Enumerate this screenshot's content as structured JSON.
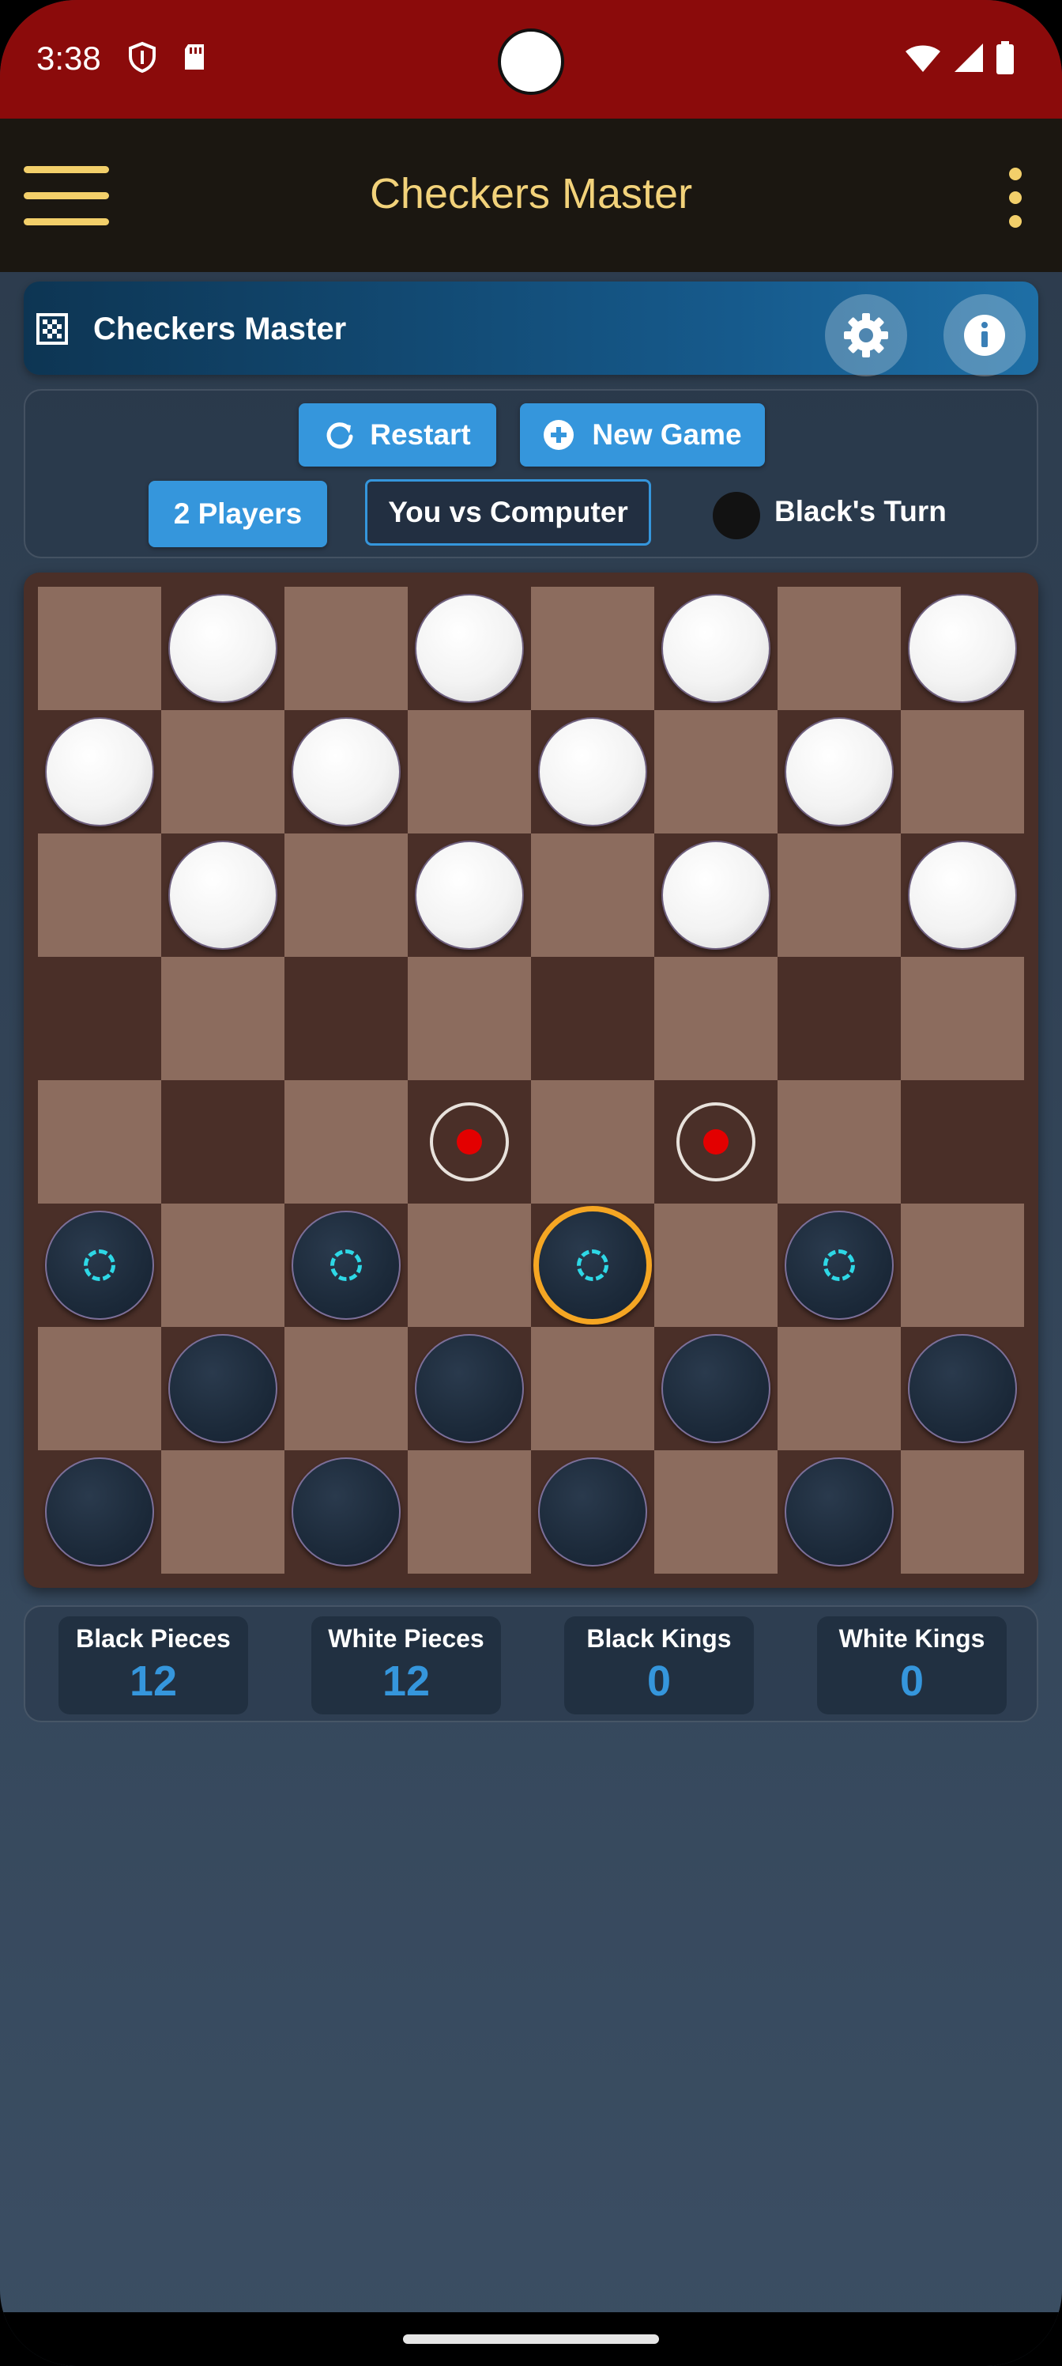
{
  "status_bar": {
    "time": "3:38"
  },
  "app_bar": {
    "title": "Checkers Master"
  },
  "header": {
    "title": "Checkers Master"
  },
  "controls": {
    "restart_label": "Restart",
    "new_game_label": "New Game",
    "mode_two_players": "2 Players",
    "mode_vs_computer": "You vs Computer",
    "turn_text": "Black's Turn"
  },
  "board": {
    "size": 8,
    "rows": [
      "-w-w-w-w",
      "w-w-w-w-",
      "-w-w-w-w",
      "--------",
      "---x-x--",
      "b-b-B-b-",
      "-b-b-b-b",
      "b-b-b-b-"
    ],
    "legend": {
      "w": "white piece",
      "b": "black piece",
      "B": "selected black piece",
      "x": "possible move"
    },
    "movable_pieces": [
      [
        5,
        0
      ],
      [
        5,
        2
      ],
      [
        5,
        4
      ],
      [
        5,
        6
      ]
    ]
  },
  "stats": [
    {
      "label": "Black Pieces",
      "value": "12"
    },
    {
      "label": "White Pieces",
      "value": "12"
    },
    {
      "label": "Black Kings",
      "value": "0"
    },
    {
      "label": "White Kings",
      "value": "0"
    }
  ],
  "colors": {
    "status_bar": "#8b0b0b",
    "app_bar": "#1b1711",
    "title_gold": "#f2d27a",
    "accent_blue": "#3596dc",
    "light_square": "#8c6c5e",
    "dark_square": "#4a2f28",
    "selection": "#f5a623",
    "move_dot": "#e30000",
    "movable_marker": "#2ed8e6"
  }
}
